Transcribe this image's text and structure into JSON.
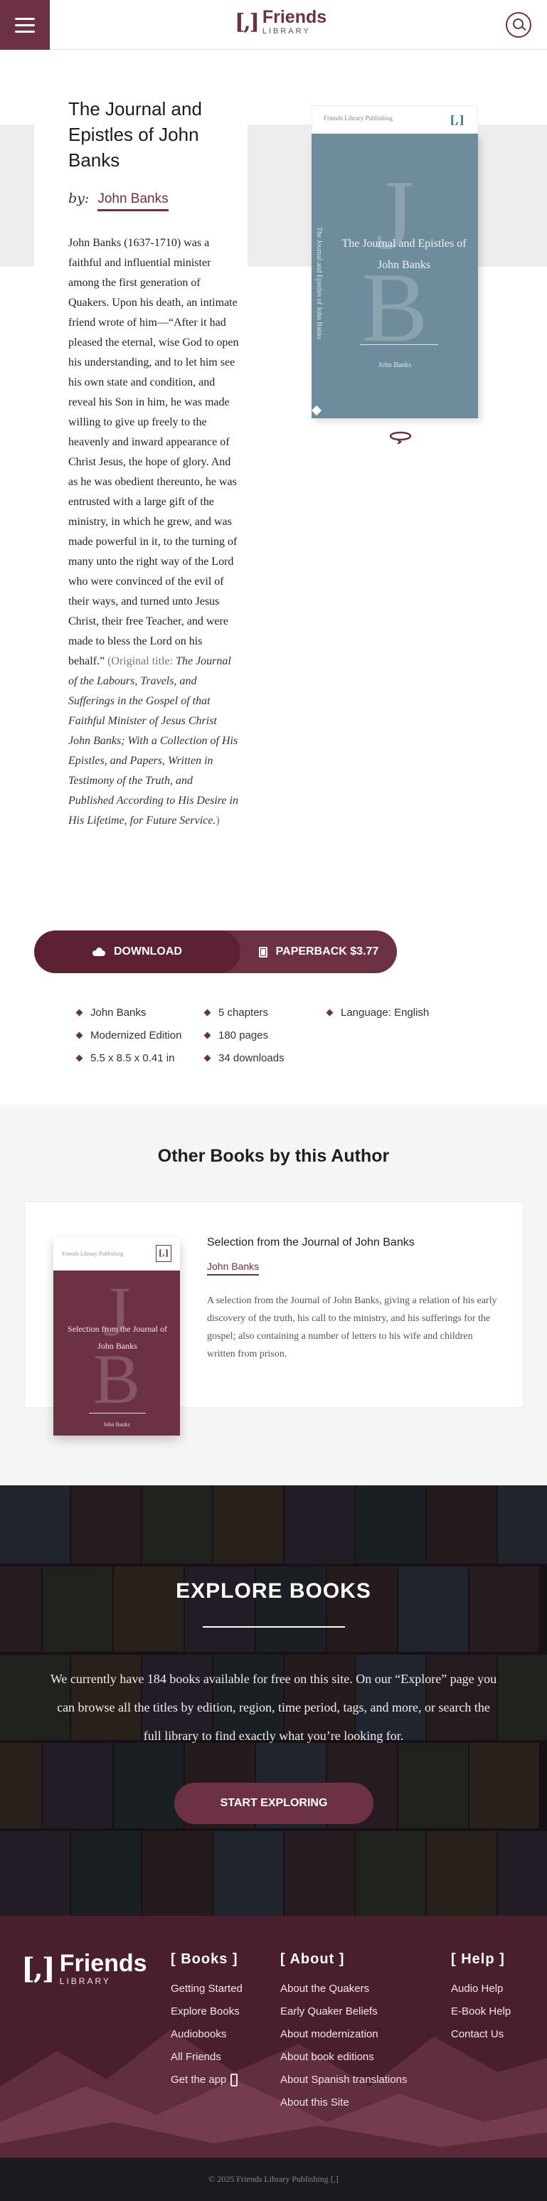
{
  "header": {
    "logo_mark": "[,]",
    "logo_name": "Friends",
    "logo_sub": "LIBRARY"
  },
  "book": {
    "title": "The Journal and Epistles of John Banks",
    "by_label": "by:",
    "author": "John Banks",
    "description_main": "John Banks (1637-1710) was a faithful and influential minister among the first generation of Quakers. Upon his death, an intimate friend wrote of him—“After it had pleased the eternal, wise God to open his understanding, and to let him see his own state and condition, and reveal his Son in him, he was made willing to give up freely to the heavenly and inward appearance of Christ Jesus, the hope of glory. And as he was obedient thereunto, he was entrusted with a large gift of the ministry, in which he grew, and was made powerful in it, to the turning of many unto the right way of the Lord who were convinced of the evil of their ways, and turned unto Jesus Christ, their free Teacher, and were made to bless the Lord on his behalf.”",
    "original_prefix": "(Original title: ",
    "original_title": "The Journal of the Labours, Travels, and Sufferings in the Gospel of that Faithful Minister of Jesus Christ John Banks; With a Collection of His Epistles, and Papers, Written in Testimony of the Truth, and Published According to His Desire in His Lifetime, for Future Service.",
    "original_suffix": ")",
    "cover": {
      "publisher": "Friends Library Publishing",
      "mini_logo": "[,]",
      "monogram_top": "J",
      "monogram_bottom": "B",
      "title": "The Journal and Epistles of John Banks",
      "author": "John Banks",
      "spine": "The Journal and Epistles of John Banks",
      "color": "#6e8c9c"
    }
  },
  "actions": {
    "download": "DOWNLOAD",
    "paperback": "PAPERBACK $3.77"
  },
  "meta": {
    "author": "John Banks",
    "chapters": "5 chapters",
    "language": "Language: English",
    "edition": "Modernized Edition",
    "pages": "180 pages",
    "size": "5.5 x 8.5 x 0.41 in",
    "downloads": "34 downloads"
  },
  "other_books": {
    "heading": "Other Books by this Author",
    "items": [
      {
        "title": "Selection from the Journal of John Banks",
        "author": "John Banks",
        "description": "A selection from the Journal of John Banks, giving a relation of his early discovery of the truth, his call to the ministry, and his sufferings for the gospel; also containing a number of letters to his wife and children written from prison.",
        "cover_publisher": "Friends Library Publishing",
        "cover_mini_logo": "[,]",
        "cover_title": "Selection from the Journal of John Banks",
        "cover_author": "John Banks",
        "cover_monogram_top": "J",
        "cover_monogram_bottom": "B",
        "cover_color": "#6c3142"
      }
    ]
  },
  "explore": {
    "title": "EXPLORE BOOKS",
    "text": "We currently have 184 books available for free on this site. On our “Explore” page you can browse all the titles by edition, region, time period, tags, and more, or search the full library to find exactly what you’re looking for.",
    "button": "START EXPLORING"
  },
  "footer": {
    "logo_mark": "[,]",
    "logo_name": "Friends",
    "logo_sub": "LIBRARY",
    "books": {
      "heading": "[ Books ]",
      "links": [
        "Getting Started",
        "Explore Books",
        "Audiobooks",
        "All Friends",
        "Get the app"
      ]
    },
    "about": {
      "heading": "[ About ]",
      "links": [
        "About the Quakers",
        "Early Quaker Beliefs",
        "About modernization",
        "About book editions",
        "About Spanish translations",
        "About this Site"
      ]
    },
    "help": {
      "heading": "[ Help ]",
      "links": [
        "Audio Help",
        "E-Book Help",
        "Contact Us"
      ]
    },
    "copyright": "© 2025 Friends Library Publishing [,]"
  },
  "colors": {
    "accent": "#6c3142",
    "accent_dark": "#5c2234",
    "footer_bg": "#4a1f2c"
  }
}
